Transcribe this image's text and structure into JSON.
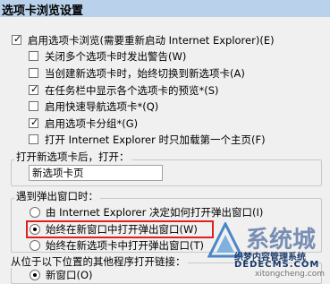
{
  "window": {
    "title": "选项卡浏览设置"
  },
  "main_checkbox": {
    "label": "启用选项卡浏览(需要重新启动 Internet Explorer)(E)",
    "checked": true
  },
  "options": [
    {
      "label": "关闭多个选项卡时发出警告(W)",
      "checked": false
    },
    {
      "label": "当创建新选项卡时，始终切换到新选项卡(A)",
      "checked": false
    },
    {
      "label": "在任务栏中显示各个选项卡的预览*(S)",
      "checked": true
    },
    {
      "label": "启用快速导航选项卡*(Q)",
      "checked": false
    },
    {
      "label": "启用选项卡分组*(G)",
      "checked": true
    },
    {
      "label": "打开 Internet Explorer 时只加载第一个主页(F)",
      "checked": false
    }
  ],
  "new_tab_group": {
    "title": "打开新选项卡后，打开：",
    "selected": "新选项卡页"
  },
  "popup_group": {
    "title": "遇到弹出窗口时：",
    "options": [
      {
        "label": "由 Internet Explorer 决定如何打开弹出窗口(I)",
        "selected": false
      },
      {
        "label": "始终在新窗口中打开弹出窗口(W)",
        "selected": true
      },
      {
        "label": "始终在新选项卡中打开弹出窗口(T)",
        "selected": false
      }
    ]
  },
  "external_group": {
    "title": "从位于以下位置的其他程序打开链接：",
    "options": [
      {
        "label": "新窗口(O)",
        "selected": true
      }
    ]
  },
  "watermark": {
    "brand": "系统城",
    "text1": "织梦内容管理系统",
    "text2": "DEDECMS.COM",
    "text3": "xitongcheng.com"
  },
  "colors": {
    "highlight": "#e02020",
    "titlebar": "#b9d1ea"
  }
}
